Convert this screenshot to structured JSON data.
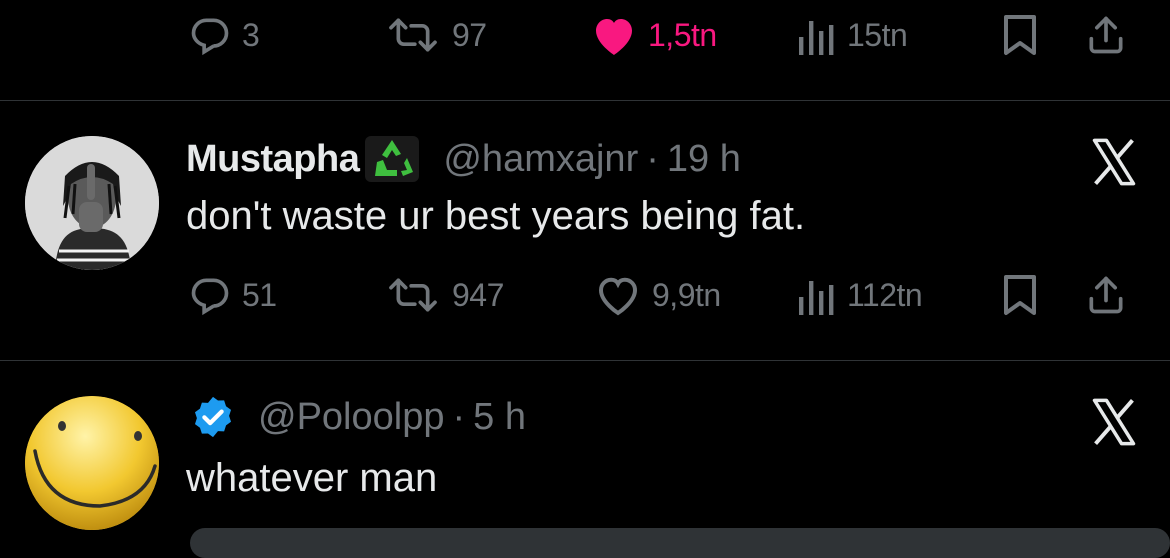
{
  "top_tweet": {
    "actions": {
      "replies": "3",
      "retweets": "97",
      "likes": "1,5tn",
      "views": "15tn",
      "liked": true
    }
  },
  "tweet_mustapha": {
    "name": "Mustapha",
    "badge_icon": "recycle-icon",
    "handle": "@hamxajnr",
    "separator": "·",
    "time": "19 h",
    "text": "don't waste ur best years being fat.",
    "actions": {
      "replies": "51",
      "retweets": "947",
      "likes": "9,9tn",
      "views": "112tn"
    }
  },
  "tweet_poloolpp": {
    "verified_icon": "verified-badge-icon",
    "handle": "@Poloolpp",
    "separator": "·",
    "time": "5 h",
    "text": "whatever man"
  },
  "colors": {
    "background": "#000000",
    "text": "#e7e9ea",
    "muted": "#71767b",
    "like_active": "#f91880",
    "verified": "#1d9bf0",
    "divider": "#2f3336"
  }
}
